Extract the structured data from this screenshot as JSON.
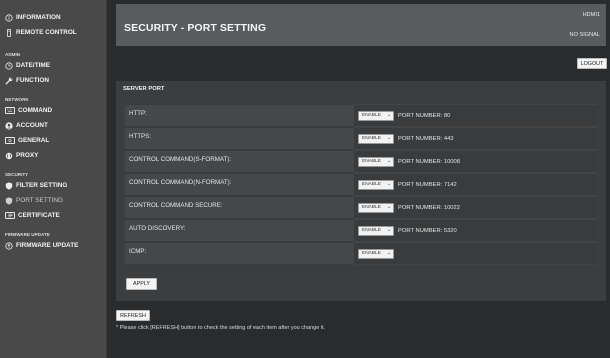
{
  "sidebar": {
    "information": "INFORMATION",
    "remote_control": "REMOTE CONTROL",
    "section_admin": "ADMIN",
    "datetime": "DATE/TIME",
    "function": "FUNCTION",
    "section_network": "NETWORK",
    "command": "COMMAND",
    "account": "ACCOUNT",
    "general": "GENERAL",
    "proxy": "PROXY",
    "section_security": "SECURITY",
    "filter_setting": "FILTER SETTING",
    "port_setting": "PORT SETTING",
    "certificate": "CERTIFICATE",
    "section_firmware": "FIRMWARE UPDATE",
    "firmware_update": "FIRMWARE UPDATE"
  },
  "header": {
    "title": "SECURITY - PORT SETTING",
    "input": "HDMI1",
    "signal": "NO SIGNAL"
  },
  "logout_label": "LOGOUT",
  "panel": {
    "title": "SERVER PORT",
    "rows": [
      {
        "label": "HTTP:",
        "value": "ENABLE",
        "port": "PORT NUMBER: 80"
      },
      {
        "label": "HTTPS:",
        "value": "ENABLE",
        "port": "PORT NUMBER: 443"
      },
      {
        "label": "CONTROL COMMAND(S-FORMAT):",
        "value": "ENABLE",
        "port": "PORT NUMBER: 10008"
      },
      {
        "label": "CONTROL COMMAND(N-FORMAT):",
        "value": "ENABLE",
        "port": "PORT NUMBER: 7142"
      },
      {
        "label": "CONTROL COMMAND SECURE:",
        "value": "ENABLE",
        "port": "PORT NUMBER: 10022"
      },
      {
        "label": "AUTO DISCOVERY:",
        "value": "ENABLE",
        "port": "PORT NUMBER: 5320"
      },
      {
        "label": "ICMP:",
        "value": "ENABLE",
        "port": ""
      }
    ],
    "apply_label": "APPLY"
  },
  "refresh_label": "REFRESH",
  "note": "* Please click [REFRESH] button to check the setting of each item after you change it.",
  "icons": {
    "info": "info-circle-icon",
    "remote": "remote-icon",
    "clock": "clock-icon",
    "wrench": "wrench-icon",
    "keyboard": "keyboard-icon",
    "user": "user-icon",
    "general": "general-box-icon",
    "globe": "globe-icon",
    "shield": "shield-icon",
    "certificate": "certificate-icon",
    "upload": "firmware-icon"
  }
}
